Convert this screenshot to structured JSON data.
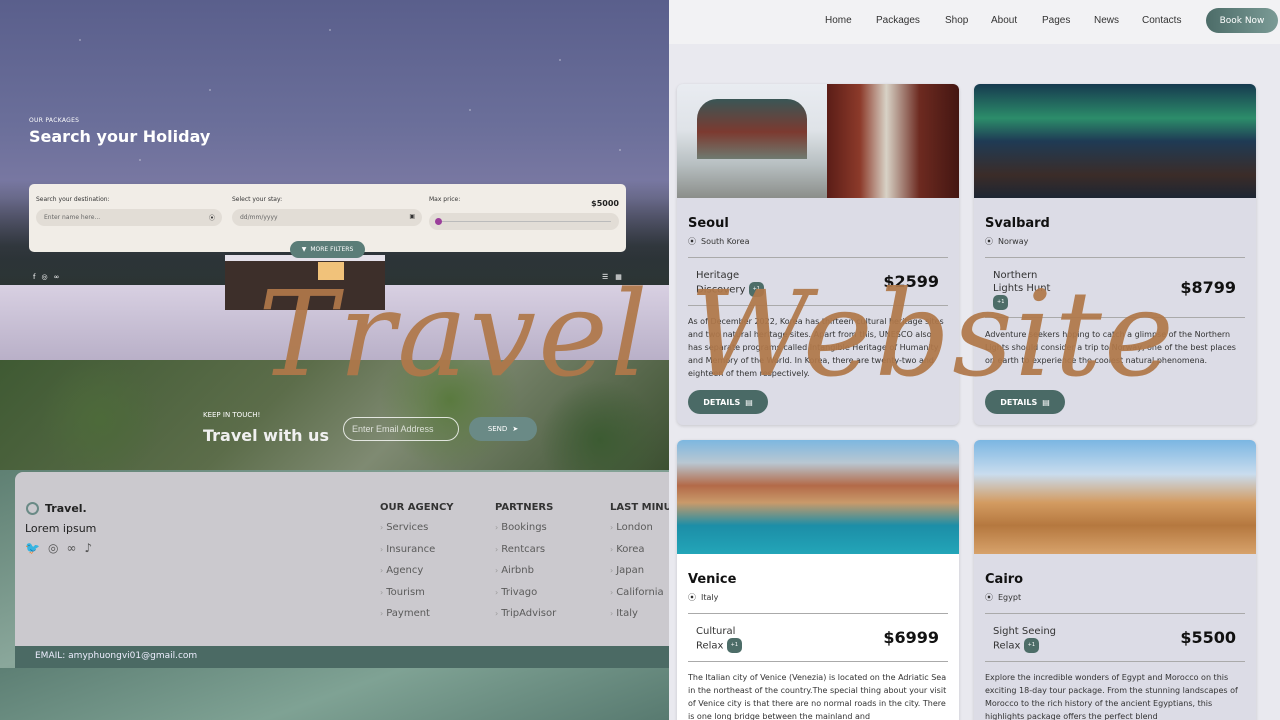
{
  "hero": {
    "subtitle": "OUR PACKAGES",
    "title": "Search your Holiday"
  },
  "search": {
    "destination_label": "Search your destination:",
    "destination_placeholder": "Enter name here...",
    "stay_label": "Select your stay:",
    "stay_value": "dd/mm/yyyy",
    "price_label": "Max price:",
    "price_value": "$5000",
    "price_slider_fraction": 0.0,
    "more_filters": "MORE FILTERS"
  },
  "newsletter": {
    "subtitle": "KEEP IN TOUCH!",
    "title": "Travel with us",
    "email_placeholder": "Enter Email Address",
    "send_label": "SEND"
  },
  "footer": {
    "brand": "Travel.",
    "tagline": "Lorem ipsum",
    "columns": [
      {
        "title": "OUR AGENCY",
        "items": [
          "Services",
          "Insurance",
          "Agency",
          "Tourism",
          "Payment"
        ]
      },
      {
        "title": "PARTNERS",
        "items": [
          "Bookings",
          "Rentcars",
          "Airbnb",
          "Trivago",
          "TripAdvisor"
        ]
      },
      {
        "title": "LAST MINUTE",
        "items": [
          "London",
          "Korea",
          "Japan",
          "California",
          "Italy"
        ]
      }
    ],
    "email": "EMAIL: amyphuongvi01@gmail.com"
  },
  "nav": {
    "items": [
      "Home",
      "Packages",
      "Shop",
      "About",
      "Pages",
      "News",
      "Contacts"
    ],
    "book_now": "Book Now"
  },
  "cards": [
    {
      "name": "Seoul",
      "location": "South Korea",
      "tags": "Heritage Discovery",
      "badge": "+1",
      "price": "$2599",
      "description": "As of December 2022, Korea has thirteen cultural heritage sites and two natural heritage sites. Apart from this, UNESCO also has separate programs called Intangible Heritage of Humanity and Memory of the World. In Korea, there are twenty-two and eighteen of them respectively.",
      "details": "DETAILS"
    },
    {
      "name": "Svalbard",
      "location": "Norway",
      "tags": "Northern Lights Hunt",
      "badge": "+1",
      "price": "$8799",
      "description": "Adventure seekers hoping to catch a glimpse of the Northern Lights should consider a trip to Norway, one of the best places on earth to experience the coolest natural phenomena.",
      "details": "DETAILS"
    },
    {
      "name": "Venice",
      "location": "Italy",
      "tags": "Cultural Relax",
      "badge": "+1",
      "price": "$6999",
      "description": "The Italian city of Venice (Venezia) is located on the Adriatic Sea in the northeast of the country.The special thing about your visit of Venice city is that there are no normal roads in the city. There is one long bridge between the mainland and",
      "details": "DETAILS"
    },
    {
      "name": "Cairo",
      "location": "Egypt",
      "tags": "Sight Seeing Relax",
      "badge": "+1",
      "price": "$5500",
      "description": "Explore the incredible wonders of Egypt and Morocco on this exciting 18-day tour package. From the stunning landscapes of Morocco to the rich history of the ancient Egyptians, this highlights package offers the perfect blend",
      "details": "DETAILS"
    }
  ],
  "overlay": {
    "title": "Travel Website"
  },
  "colors": {
    "accent": "#4b6a64",
    "overlay_text": "#b0784a",
    "slider_thumb": "#9b3f9b"
  }
}
